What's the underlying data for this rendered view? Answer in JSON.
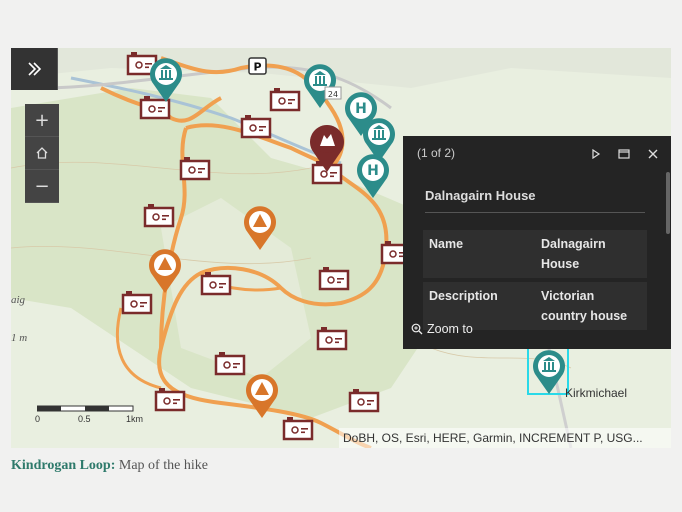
{
  "map": {
    "expand_icon": "double-chevron-right-icon",
    "zoom_in": "+",
    "home_icon": "home-icon",
    "zoom_out": "−",
    "road_shield_parking": "P",
    "road_shield_number": "24",
    "edge_label_1": "aig",
    "edge_label_2": "1 m",
    "town_label": "Kirkmichael",
    "scalebar": {
      "labels": [
        "0",
        "0.5",
        "1km"
      ]
    },
    "attribution": "DoBH, OS, Esri, HERE, Garmin, INCREMENT P, USG...",
    "colors": {
      "route": "#f0a050",
      "poi_brown": "#7a2b2b",
      "poi_teal": "#2c8c8a",
      "poi_orange": "#d8762a",
      "selection": "#29d9e8"
    }
  },
  "popup": {
    "pager": "(1 of 2)",
    "title": "Dalnagairn House",
    "rows": [
      {
        "key": "Name",
        "value_line1": "Dalnagairn",
        "value_line2": "House"
      },
      {
        "key": "Description",
        "value_line1": "Victorian",
        "value_line2": "country house"
      }
    ],
    "zoom_to": "Zoom to"
  },
  "caption": {
    "bold": "Kindrogan Loop:",
    "text": "Map of the hike"
  }
}
